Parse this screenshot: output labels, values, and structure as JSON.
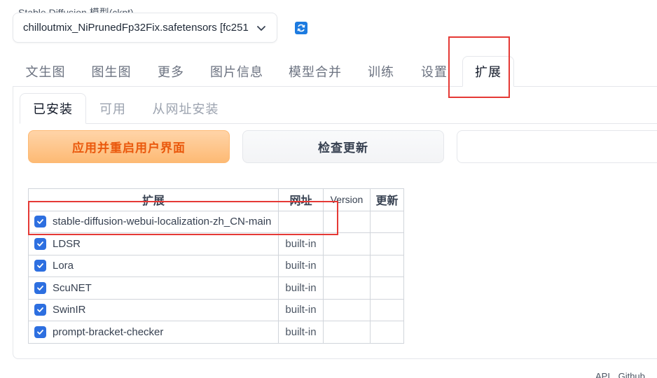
{
  "model": {
    "label": "Stable Diffusion 模型(ckpt)",
    "value": "chilloutmix_NiPrunedFp32Fix.safetensors [fc251"
  },
  "main_tabs": [
    {
      "label": "文生图"
    },
    {
      "label": "图生图"
    },
    {
      "label": "更多"
    },
    {
      "label": "图片信息"
    },
    {
      "label": "模型合并"
    },
    {
      "label": "训练"
    },
    {
      "label": "设置"
    },
    {
      "label": "扩展",
      "active": true
    }
  ],
  "sub_tabs": [
    {
      "label": "已安装",
      "active": true
    },
    {
      "label": "可用"
    },
    {
      "label": "从网址安装"
    }
  ],
  "buttons": {
    "apply_restart": "应用并重启用户界面",
    "check_updates": "检查更新"
  },
  "table": {
    "headers": [
      "扩展",
      "网址",
      "Version",
      "更新"
    ],
    "rows": [
      {
        "name": "stable-diffusion-webui-localization-zh_CN-main",
        "url": "",
        "version": "",
        "update": "",
        "checked": true
      },
      {
        "name": "LDSR",
        "url": "built-in",
        "version": "",
        "update": "",
        "checked": true
      },
      {
        "name": "Lora",
        "url": "built-in",
        "version": "",
        "update": "",
        "checked": true
      },
      {
        "name": "ScuNET",
        "url": "built-in",
        "version": "",
        "update": "",
        "checked": true
      },
      {
        "name": "SwinIR",
        "url": "built-in",
        "version": "",
        "update": "",
        "checked": true
      },
      {
        "name": "prompt-bracket-checker",
        "url": "built-in",
        "version": "",
        "update": "",
        "checked": true
      }
    ]
  },
  "footer": {
    "links": [
      "API",
      "Github"
    ]
  },
  "colors": {
    "accent_orange": "#ea580c",
    "checkbox_blue": "#2d6fe0",
    "highlight_red": "#e53935",
    "refresh_blue": "#1d7be0"
  },
  "icons": {
    "refresh": "refresh-icon",
    "dropdown": "chevron-down-icon",
    "check": "checkmark-icon"
  }
}
